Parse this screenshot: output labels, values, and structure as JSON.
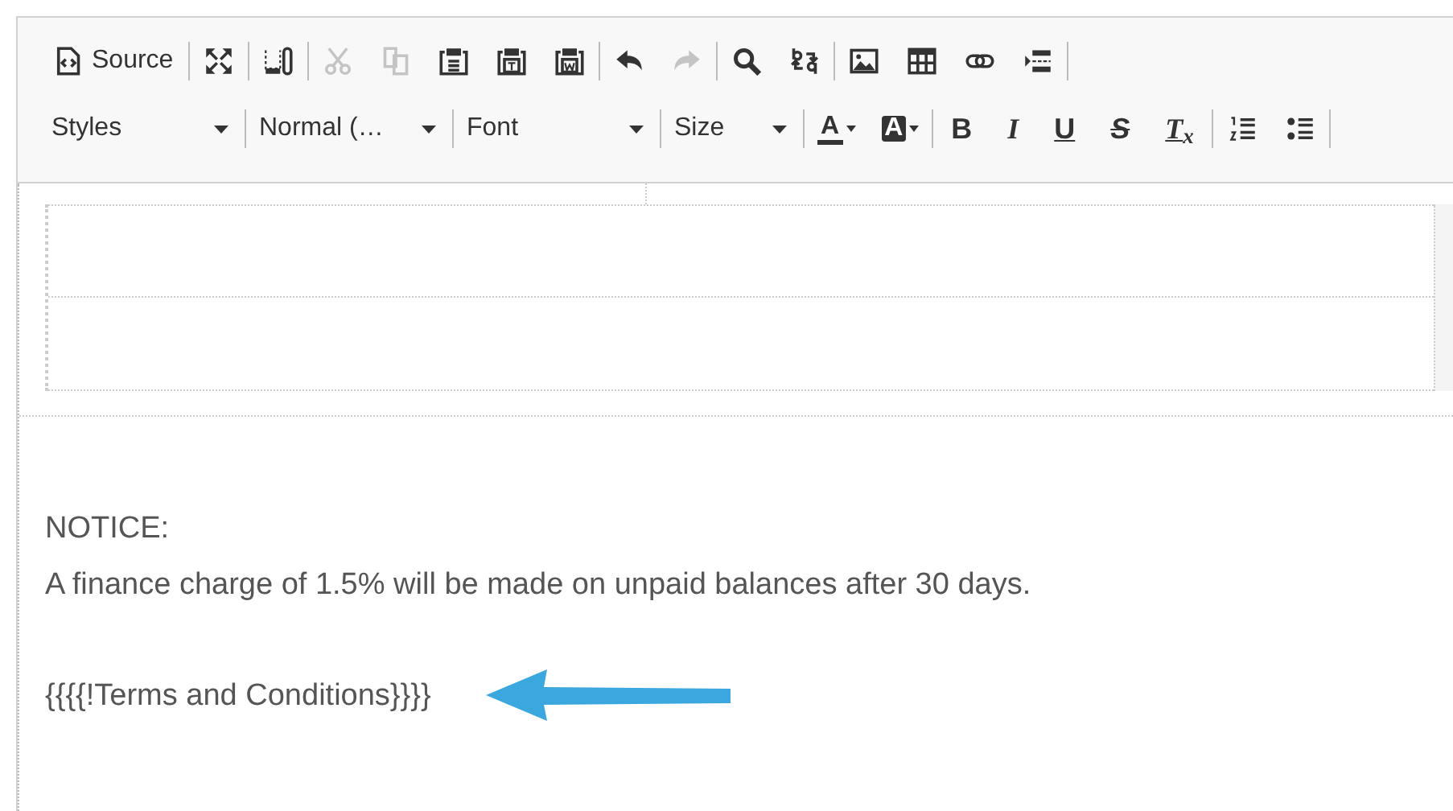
{
  "toolbar": {
    "rows": [
      {
        "groups": [
          {
            "items": [
              {
                "kind": "source",
                "label": "Source",
                "disabled": false
              }
            ]
          },
          {
            "items": [
              {
                "kind": "maximize",
                "disabled": false
              }
            ]
          },
          {
            "items": [
              {
                "kind": "blocks",
                "disabled": false
              }
            ]
          },
          {
            "items": [
              {
                "kind": "cut",
                "disabled": true
              },
              {
                "kind": "copy",
                "disabled": true
              },
              {
                "kind": "paste",
                "disabled": false
              },
              {
                "kind": "paste-text",
                "disabled": false
              },
              {
                "kind": "paste-word",
                "disabled": false
              }
            ]
          },
          {
            "items": [
              {
                "kind": "undo",
                "disabled": false
              },
              {
                "kind": "redo",
                "disabled": true
              }
            ]
          },
          {
            "items": [
              {
                "kind": "find",
                "disabled": false
              },
              {
                "kind": "replace",
                "disabled": false
              }
            ]
          },
          {
            "items": [
              {
                "kind": "image",
                "disabled": false
              },
              {
                "kind": "table",
                "disabled": false
              },
              {
                "kind": "link",
                "disabled": false
              },
              {
                "kind": "pagebreak",
                "disabled": false
              }
            ]
          }
        ]
      },
      {
        "groups": [
          {
            "items": [
              {
                "kind": "combo",
                "label": "Styles"
              }
            ]
          },
          {
            "items": [
              {
                "kind": "combo",
                "label": "Normal (…"
              }
            ]
          },
          {
            "items": [
              {
                "kind": "combo",
                "label": "Font"
              }
            ]
          },
          {
            "items": [
              {
                "kind": "combo",
                "label": "Size",
                "narrow": true
              }
            ]
          },
          {
            "items": [
              {
                "kind": "text-color",
                "glyph": "A",
                "disabled": false
              },
              {
                "kind": "bg-color",
                "glyph": "A",
                "disabled": false
              }
            ]
          },
          {
            "items": [
              {
                "kind": "bold",
                "glyph": "B",
                "disabled": false
              },
              {
                "kind": "italic",
                "glyph": "I",
                "disabled": false
              },
              {
                "kind": "underline",
                "glyph": "U",
                "disabled": false
              },
              {
                "kind": "strike",
                "glyph": "S",
                "disabled": false
              },
              {
                "kind": "remove-format",
                "glyph": "T$_{x}$",
                "disabled": false
              }
            ]
          },
          {
            "items": [
              {
                "kind": "numbered-list",
                "disabled": false
              },
              {
                "kind": "bullet-list",
                "disabled": false
              }
            ]
          }
        ]
      }
    ]
  },
  "content": {
    "notice_title": "NOTICE:",
    "notice_text": "A finance charge of 1.5% will be made on unpaid balances after 30 days.",
    "merge_field": "{{{{!Terms and Conditions}}}}"
  }
}
